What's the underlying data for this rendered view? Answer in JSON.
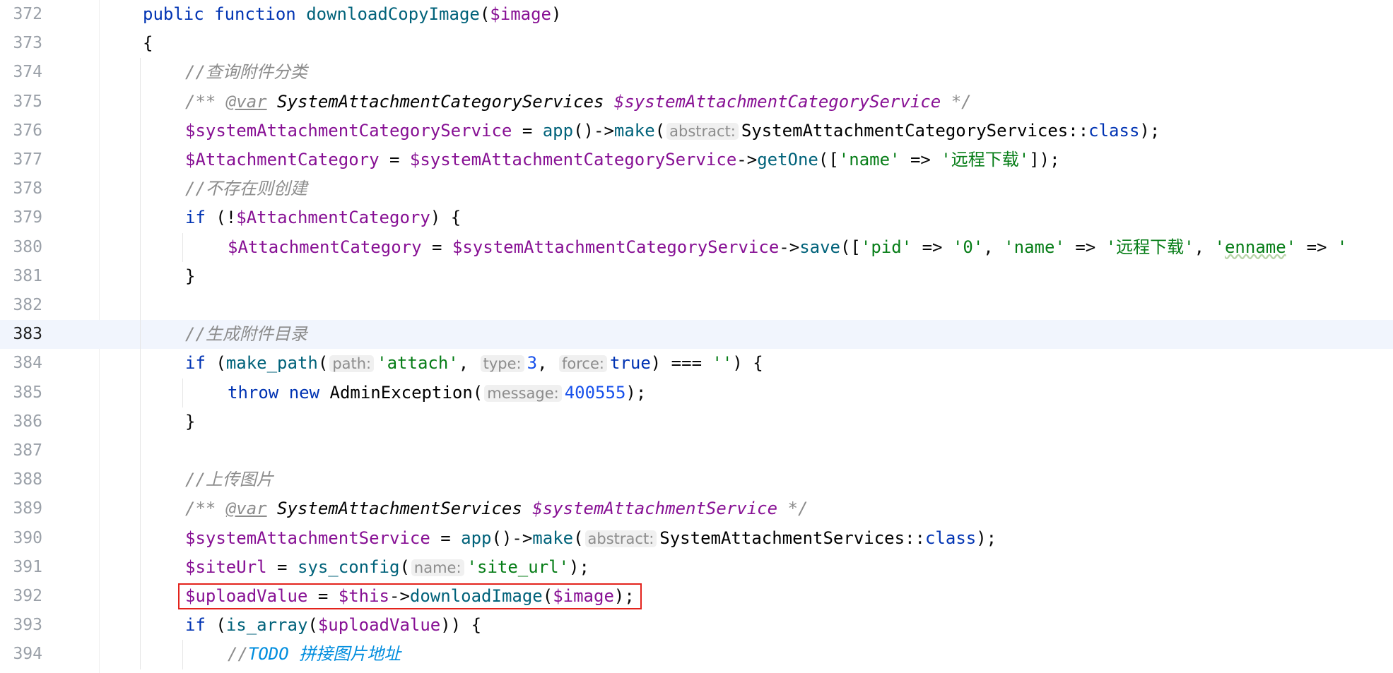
{
  "editor": {
    "lines": [
      {
        "n": "372",
        "indent": 0,
        "tokens": [
          {
            "t": "public ",
            "c": "kw"
          },
          {
            "t": "function ",
            "c": "kw"
          },
          {
            "t": "downloadCopyImage",
            "c": "fn"
          },
          {
            "t": "(",
            "c": "plain"
          },
          {
            "t": "$image",
            "c": "var"
          },
          {
            "t": ")",
            "c": "plain"
          }
        ]
      },
      {
        "n": "373",
        "indent": 0,
        "tokens": [
          {
            "t": "{",
            "c": "plain"
          }
        ]
      },
      {
        "n": "374",
        "indent": 1,
        "tokens": [
          {
            "t": "//",
            "c": "cmt"
          },
          {
            "t": "查询附件分类",
            "c": "cmtbody"
          }
        ]
      },
      {
        "n": "375",
        "indent": 1,
        "tokens": [
          {
            "t": "/** ",
            "c": "cmt"
          },
          {
            "t": "@var",
            "c": "tag"
          },
          {
            "t": " ",
            "c": "cmt"
          },
          {
            "t": "SystemAttachmentCategoryServices ",
            "c": "doctype"
          },
          {
            "t": "$systemAttachmentCategoryService",
            "c": "docvar"
          },
          {
            "t": " */",
            "c": "cmt"
          }
        ]
      },
      {
        "n": "376",
        "indent": 1,
        "tokens": [
          {
            "t": "$systemAttachmentCategoryService",
            "c": "var"
          },
          {
            "t": " = ",
            "c": "plain"
          },
          {
            "t": "app",
            "c": "fn"
          },
          {
            "t": "()->",
            "c": "plain"
          },
          {
            "t": "make",
            "c": "fn"
          },
          {
            "t": "(",
            "c": "plain"
          },
          {
            "t": "abstract:",
            "c": "hint"
          },
          {
            "t": "SystemAttachmentCategoryServices",
            "c": "cls"
          },
          {
            "t": "::",
            "c": "plain"
          },
          {
            "t": "class",
            "c": "kw"
          },
          {
            "t": ");",
            "c": "plain"
          }
        ]
      },
      {
        "n": "377",
        "indent": 1,
        "tokens": [
          {
            "t": "$AttachmentCategory",
            "c": "var"
          },
          {
            "t": " = ",
            "c": "plain"
          },
          {
            "t": "$systemAttachmentCategoryService",
            "c": "var"
          },
          {
            "t": "->",
            "c": "plain"
          },
          {
            "t": "getOne",
            "c": "fn"
          },
          {
            "t": "([",
            "c": "plain"
          },
          {
            "t": "'name'",
            "c": "str"
          },
          {
            "t": " => ",
            "c": "plain"
          },
          {
            "t": "'",
            "c": "str"
          },
          {
            "t": "远程下载",
            "c": "str cn-str"
          },
          {
            "t": "'",
            "c": "str"
          },
          {
            "t": "]);",
            "c": "plain"
          }
        ]
      },
      {
        "n": "378",
        "indent": 1,
        "tokens": [
          {
            "t": "//",
            "c": "cmt"
          },
          {
            "t": "不存在则创建",
            "c": "cmtbody"
          }
        ]
      },
      {
        "n": "379",
        "indent": 1,
        "tokens": [
          {
            "t": "if",
            "c": "kw"
          },
          {
            "t": " (!",
            "c": "plain"
          },
          {
            "t": "$AttachmentCategory",
            "c": "var"
          },
          {
            "t": ") {",
            "c": "plain"
          }
        ]
      },
      {
        "n": "380",
        "indent": 2,
        "tokens": [
          {
            "t": "$AttachmentCategory",
            "c": "var"
          },
          {
            "t": " = ",
            "c": "plain"
          },
          {
            "t": "$systemAttachmentCategoryService",
            "c": "var"
          },
          {
            "t": "->",
            "c": "plain"
          },
          {
            "t": "save",
            "c": "fn"
          },
          {
            "t": "([",
            "c": "plain"
          },
          {
            "t": "'pid'",
            "c": "str"
          },
          {
            "t": " => ",
            "c": "plain"
          },
          {
            "t": "'0'",
            "c": "str"
          },
          {
            "t": ", ",
            "c": "plain"
          },
          {
            "t": "'name'",
            "c": "str"
          },
          {
            "t": " => ",
            "c": "plain"
          },
          {
            "t": "'",
            "c": "str"
          },
          {
            "t": "远程下载",
            "c": "str cn-str"
          },
          {
            "t": "'",
            "c": "str"
          },
          {
            "t": ", ",
            "c": "plain"
          },
          {
            "t": "'",
            "c": "str"
          },
          {
            "t": "enname",
            "c": "str typo"
          },
          {
            "t": "'",
            "c": "str"
          },
          {
            "t": " => ",
            "c": "plain"
          },
          {
            "t": "'",
            "c": "str"
          }
        ]
      },
      {
        "n": "381",
        "indent": 1,
        "tokens": [
          {
            "t": "}",
            "c": "plain"
          }
        ]
      },
      {
        "n": "382",
        "indent": 1,
        "tokens": []
      },
      {
        "n": "383",
        "indent": 1,
        "current": true,
        "tokens": [
          {
            "t": "//",
            "c": "cmt"
          },
          {
            "t": "生成附件目录",
            "c": "cmtbody"
          }
        ]
      },
      {
        "n": "384",
        "indent": 1,
        "tokens": [
          {
            "t": "if",
            "c": "kw"
          },
          {
            "t": " (",
            "c": "plain"
          },
          {
            "t": "make_path",
            "c": "fn"
          },
          {
            "t": "(",
            "c": "plain"
          },
          {
            "t": "path:",
            "c": "hint"
          },
          {
            "t": "'attach'",
            "c": "str"
          },
          {
            "t": ", ",
            "c": "plain"
          },
          {
            "t": "type:",
            "c": "hint"
          },
          {
            "t": "3",
            "c": "num"
          },
          {
            "t": ", ",
            "c": "plain"
          },
          {
            "t": "force:",
            "c": "hint"
          },
          {
            "t": "true",
            "c": "kw"
          },
          {
            "t": ") === ",
            "c": "plain"
          },
          {
            "t": "''",
            "c": "str"
          },
          {
            "t": ") {",
            "c": "plain"
          }
        ]
      },
      {
        "n": "385",
        "indent": 2,
        "tokens": [
          {
            "t": "throw ",
            "c": "kw"
          },
          {
            "t": "new ",
            "c": "kw"
          },
          {
            "t": "AdminException",
            "c": "cls"
          },
          {
            "t": "(",
            "c": "plain"
          },
          {
            "t": "message:",
            "c": "hint"
          },
          {
            "t": "400555",
            "c": "num"
          },
          {
            "t": ");",
            "c": "plain"
          }
        ]
      },
      {
        "n": "386",
        "indent": 1,
        "tokens": [
          {
            "t": "}",
            "c": "plain"
          }
        ]
      },
      {
        "n": "387",
        "indent": 1,
        "tokens": []
      },
      {
        "n": "388",
        "indent": 1,
        "tokens": [
          {
            "t": "//",
            "c": "cmt"
          },
          {
            "t": "上传图片",
            "c": "cmtbody"
          }
        ]
      },
      {
        "n": "389",
        "indent": 1,
        "tokens": [
          {
            "t": "/** ",
            "c": "cmt"
          },
          {
            "t": "@var",
            "c": "tag"
          },
          {
            "t": " ",
            "c": "cmt"
          },
          {
            "t": "SystemAttachmentServices ",
            "c": "doctype"
          },
          {
            "t": "$systemAttachmentService",
            "c": "docvar"
          },
          {
            "t": " */",
            "c": "cmt"
          }
        ]
      },
      {
        "n": "390",
        "indent": 1,
        "tokens": [
          {
            "t": "$systemAttachmentService",
            "c": "var"
          },
          {
            "t": " = ",
            "c": "plain"
          },
          {
            "t": "app",
            "c": "fn"
          },
          {
            "t": "()->",
            "c": "plain"
          },
          {
            "t": "make",
            "c": "fn"
          },
          {
            "t": "(",
            "c": "plain"
          },
          {
            "t": "abstract:",
            "c": "hint"
          },
          {
            "t": "SystemAttachmentServices",
            "c": "cls"
          },
          {
            "t": "::",
            "c": "plain"
          },
          {
            "t": "class",
            "c": "kw"
          },
          {
            "t": ");",
            "c": "plain"
          }
        ]
      },
      {
        "n": "391",
        "indent": 1,
        "tokens": [
          {
            "t": "$siteUrl",
            "c": "var"
          },
          {
            "t": " = ",
            "c": "plain"
          },
          {
            "t": "sys_config",
            "c": "fn"
          },
          {
            "t": "(",
            "c": "plain"
          },
          {
            "t": "name:",
            "c": "hint"
          },
          {
            "t": "'site_url'",
            "c": "str"
          },
          {
            "t": ");",
            "c": "plain"
          }
        ]
      },
      {
        "n": "392",
        "indent": 1,
        "boxed": true,
        "tokens": [
          {
            "t": "$uploadValue",
            "c": "var"
          },
          {
            "t": " = ",
            "c": "plain"
          },
          {
            "t": "$this",
            "c": "var"
          },
          {
            "t": "->",
            "c": "plain"
          },
          {
            "t": "downloadImage",
            "c": "fn"
          },
          {
            "t": "(",
            "c": "plain"
          },
          {
            "t": "$image",
            "c": "var"
          },
          {
            "t": ");",
            "c": "plain"
          }
        ]
      },
      {
        "n": "393",
        "indent": 1,
        "tokens": [
          {
            "t": "if",
            "c": "kw"
          },
          {
            "t": " (",
            "c": "plain"
          },
          {
            "t": "is_array",
            "c": "fn"
          },
          {
            "t": "(",
            "c": "plain"
          },
          {
            "t": "$uploadValue",
            "c": "var"
          },
          {
            "t": ")) {",
            "c": "plain"
          }
        ]
      },
      {
        "n": "394",
        "indent": 2,
        "tokens": [
          {
            "t": "//",
            "c": "cmt"
          },
          {
            "t": "TODO ",
            "c": "todo"
          },
          {
            "t": "拼接图片地址",
            "c": "todo-cn"
          }
        ]
      }
    ]
  }
}
